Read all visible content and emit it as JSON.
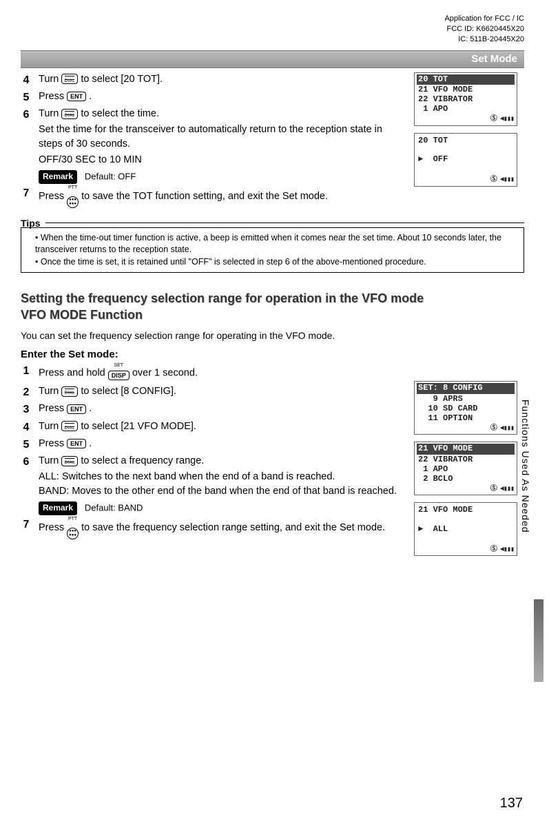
{
  "header": {
    "app": "Application for FCC / IC",
    "fcc": "FCC ID: K6620445X20",
    "ic": "IC: 511B-20445X20"
  },
  "titlebar": "Set Mode",
  "section1": {
    "steps": {
      "s4": {
        "pre": "Turn ",
        "post": " to select [20 TOT]."
      },
      "s5": {
        "pre": "Press ",
        "post": "."
      },
      "s6": {
        "pre": "Turn ",
        "post": " to select the time.",
        "desc1": "Set the time for the transceiver to automatically return to the reception state in steps of 30 seconds.",
        "desc2": "OFF/30 SEC to 10 MIN",
        "remark_lbl": "Remark",
        "remark_txt": "Default: OFF"
      },
      "s7": {
        "pre": "Press ",
        "post": " to save the TOT function setting, and exit the Set mode."
      }
    }
  },
  "tips": {
    "label": "Tips",
    "t1": "When the time-out timer function is active, a beep is emitted when it comes near the set time. About 10 seconds later, the transceiver returns to the reception state.",
    "t2": "Once the time is set, it is retained until \"OFF\" is selected in step 6 of the above-mentioned procedure."
  },
  "section2": {
    "title_l1": "Setting the frequency selection range for operation in the VFO mode",
    "title_l2": "VFO MODE Function",
    "intro": "You can set the frequency selection range for operating in the VFO mode.",
    "enter": "Enter the Set mode:",
    "steps": {
      "s1": {
        "pre": "Press and hold ",
        "post": " over 1 second."
      },
      "s2": {
        "pre": "Turn ",
        "post": " to select [8 CONFIG]."
      },
      "s3": {
        "pre": "Press ",
        "post": "."
      },
      "s4": {
        "pre": "Turn ",
        "post": " to select [21 VFO MODE]."
      },
      "s5": {
        "pre": "Press ",
        "post": "."
      },
      "s6": {
        "pre": "Turn ",
        "post": " to select a frequency range.",
        "all": "ALL: Switches to the next band when the end of a band is reached.",
        "band": "BAND: Moves to the other end of the band when the end of that band is reached.",
        "remark_lbl": "Remark",
        "remark_txt": "Default: BAND"
      },
      "s7": {
        "pre": "Press ",
        "post": " to save the frequency selection range setting, and exit the Set mode."
      }
    }
  },
  "lcds": {
    "l1": {
      "r0": "20 TOT",
      "r1": "21 VFO MODE",
      "r2": "22 VIBRATOR",
      "r3": " 1 APO"
    },
    "l2": {
      "r0": "20 TOT",
      "r1": "►  OFF"
    },
    "l3": {
      "r0": "SET: 8 CONFIG",
      "r1": "   9 APRS",
      "r2": "  10 SD CARD",
      "r3": "  11 OPTION"
    },
    "l4": {
      "r0": "21 VFO MODE",
      "r1": "22 VIBRATOR",
      "r2": " 1 APO",
      "r3": " 2 BCLO"
    },
    "l5": {
      "r0": "21 VFO MODE",
      "r1": "►  ALL"
    },
    "status": "Ⓢ ◄▮▮▮"
  },
  "key_labels": {
    "dial": "DIAL",
    "ent": "ENT",
    "disp": "DISP",
    "set": "SET",
    "ptt": "PTT"
  },
  "sidetab": "Functions Used As Needed",
  "page": "137"
}
